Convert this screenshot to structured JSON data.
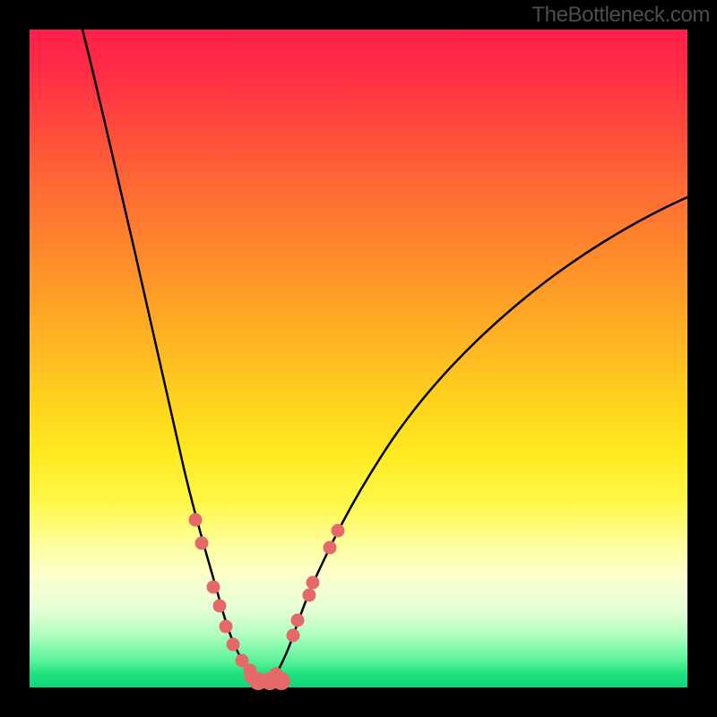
{
  "watermark": "TheBottleneck.com",
  "chart_data": {
    "type": "line",
    "title": "",
    "xlabel": "",
    "ylabel": "",
    "xlim": [
      0,
      100
    ],
    "ylim": [
      0,
      100
    ],
    "grid": false,
    "series": [
      {
        "name": "left-curve",
        "x": [
          8,
          9.8,
          12.5,
          15.9,
          18.6,
          21.3,
          23.4,
          25.8,
          27.5,
          29.3,
          30.3,
          31.0,
          31.7,
          32.8,
          33.6,
          34.6,
          35.5,
          36.5
        ],
        "y": [
          100,
          93.2,
          81.1,
          66.5,
          54.4,
          42.5,
          33.4,
          23.6,
          17.0,
          11.0,
          8.2,
          6.5,
          5.2,
          3.4,
          2.3,
          1.4,
          0.8,
          0.5
        ]
      },
      {
        "name": "right-curve",
        "x": [
          36.5,
          37.2,
          38.6,
          39.7,
          41.1,
          42.5,
          44.2,
          47.3,
          50.7,
          55.2,
          60.0,
          67.1,
          74.3,
          82.8,
          92.1,
          100
        ],
        "y": [
          0.5,
          1.4,
          4.1,
          7.1,
          10.9,
          14.4,
          18.4,
          24.9,
          31.1,
          38.1,
          44.4,
          52.2,
          58.6,
          64.8,
          70.4,
          74.5
        ]
      }
    ],
    "markers": [
      {
        "x": 25.2,
        "y": 25.5
      },
      {
        "x": 26.1,
        "y": 22.0
      },
      {
        "x": 27.9,
        "y": 15.3
      },
      {
        "x": 28.9,
        "y": 12.4
      },
      {
        "x": 29.9,
        "y": 9.3
      },
      {
        "x": 30.9,
        "y": 6.5
      },
      {
        "x": 32.3,
        "y": 4.1
      },
      {
        "x": 33.5,
        "y": 2.6
      },
      {
        "x": 33.7,
        "y": 1.6
      },
      {
        "x": 34.7,
        "y": 1.0,
        "big": true
      },
      {
        "x": 36.5,
        "y": 1.0,
        "big": true
      },
      {
        "x": 38.3,
        "y": 1.0,
        "big": true
      },
      {
        "x": 37.4,
        "y": 2.0
      },
      {
        "x": 40.0,
        "y": 7.9
      },
      {
        "x": 40.7,
        "y": 10.2
      },
      {
        "x": 42.5,
        "y": 14.1
      },
      {
        "x": 43.1,
        "y": 15.9
      },
      {
        "x": 45.6,
        "y": 21.3
      },
      {
        "x": 46.9,
        "y": 23.9
      }
    ],
    "colors": {
      "curve": "#000000",
      "marker": "#e56969",
      "gradient_top": "#ff1f4a",
      "gradient_bottom": "#10d877"
    }
  }
}
